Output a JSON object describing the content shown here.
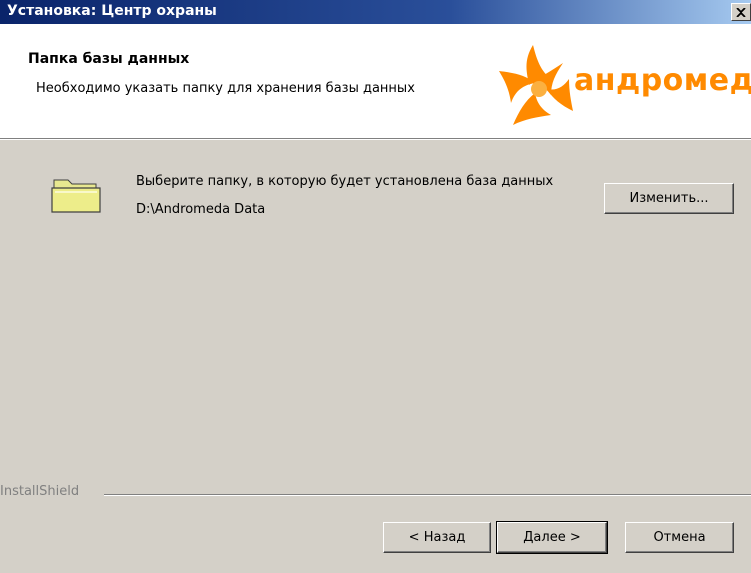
{
  "window": {
    "title": "Установка: Центр охраны",
    "close_icon": "close-icon"
  },
  "header": {
    "title": "Папка базы данных",
    "subtitle": "Необходимо указать папку для хранения базы данных",
    "logo_text": "андромеда",
    "logo_color": "#ff8a00"
  },
  "content": {
    "folder_icon": "folder-icon",
    "prompt": "Выберите папку, в которую будет установлена база данных",
    "path": "D:\\Andromeda Data",
    "change_button": "Изменить..."
  },
  "footer": {
    "brand": "InstallShield",
    "back_button": "< Назад",
    "next_button": "Далее >",
    "cancel_button": "Отмена"
  }
}
